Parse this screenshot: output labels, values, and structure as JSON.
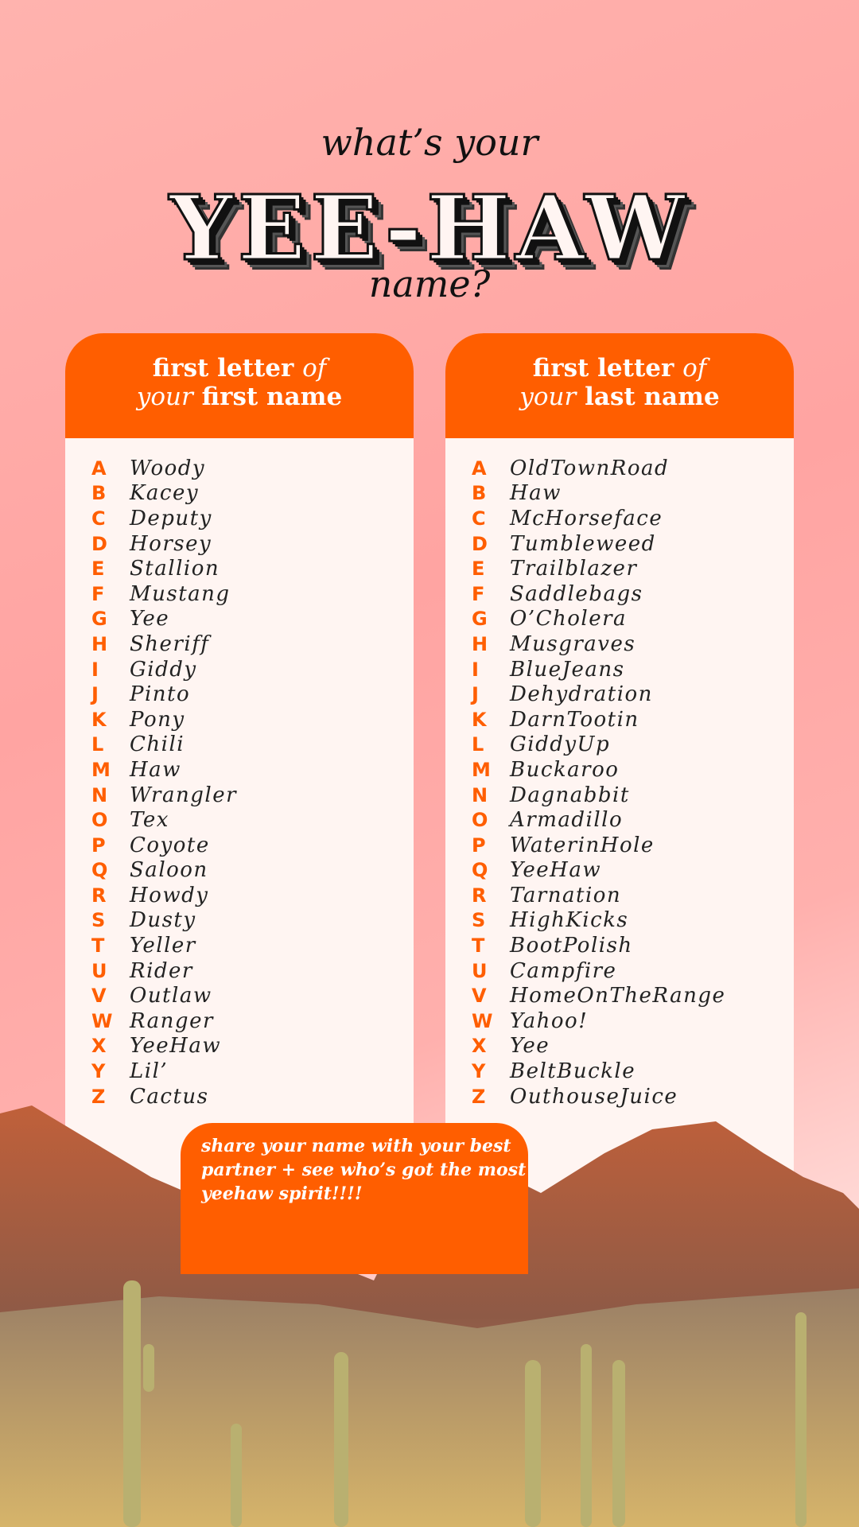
{
  "header": {
    "line1": "what’s your",
    "title": "YEE-HAW",
    "line3": "name?"
  },
  "cards": [
    {
      "head": {
        "a": "first letter",
        "b": "of",
        "c": "your",
        "d": "first name"
      },
      "rows": [
        [
          "A",
          "Woody"
        ],
        [
          "B",
          "Kacey"
        ],
        [
          "C",
          "Deputy"
        ],
        [
          "D",
          "Horsey"
        ],
        [
          "E",
          "Stallion"
        ],
        [
          "F",
          "Mustang"
        ],
        [
          "G",
          "Yee"
        ],
        [
          "H",
          "Sheriff"
        ],
        [
          "I",
          "Giddy"
        ],
        [
          "J",
          "Pinto"
        ],
        [
          "K",
          "Pony"
        ],
        [
          "L",
          "Chili"
        ],
        [
          "M",
          "Haw"
        ],
        [
          "N",
          "Wrangler"
        ],
        [
          "O",
          "Tex"
        ],
        [
          "P",
          "Coyote"
        ],
        [
          "Q",
          "Saloon"
        ],
        [
          "R",
          "Howdy"
        ],
        [
          "S",
          "Dusty"
        ],
        [
          "T",
          "Yeller"
        ],
        [
          "U",
          "Rider"
        ],
        [
          "V",
          "Outlaw"
        ],
        [
          "W",
          "Ranger"
        ],
        [
          "X",
          "YeeHaw"
        ],
        [
          "Y",
          "Lil’"
        ],
        [
          "Z",
          "Cactus"
        ]
      ]
    },
    {
      "head": {
        "a": "first letter",
        "b": "of",
        "c": "your",
        "d": "last name"
      },
      "rows": [
        [
          "A",
          "OldTownRoad"
        ],
        [
          "B",
          "Haw"
        ],
        [
          "C",
          "McHorseface"
        ],
        [
          "D",
          "Tumbleweed"
        ],
        [
          "E",
          "Trailblazer"
        ],
        [
          "F",
          "Saddlebags"
        ],
        [
          "G",
          "O’Cholera"
        ],
        [
          "H",
          "Musgraves"
        ],
        [
          "I",
          "BlueJeans"
        ],
        [
          "J",
          "Dehydration"
        ],
        [
          "K",
          "DarnTootin"
        ],
        [
          "L",
          "GiddyUp"
        ],
        [
          "M",
          "Buckaroo"
        ],
        [
          "N",
          "Dagnabbit"
        ],
        [
          "O",
          "Armadillo"
        ],
        [
          "P",
          "WaterinHole"
        ],
        [
          "Q",
          "YeeHaw"
        ],
        [
          "R",
          "Tarnation"
        ],
        [
          "S",
          "HighKicks"
        ],
        [
          "T",
          "BootPolish"
        ],
        [
          "U",
          "Campfire"
        ],
        [
          "V",
          "HomeOnTheRange"
        ],
        [
          "W",
          "Yahoo!"
        ],
        [
          "X",
          "Yee"
        ],
        [
          "Y",
          "BeltBuckle"
        ],
        [
          "Z",
          "OuthouseJuice"
        ]
      ]
    }
  ],
  "bubble": {
    "text": "share your name with your best partner + see who’s got the most yeehaw spirit!!!!"
  },
  "colors": {
    "accent": "#ff5e00",
    "card": "#fff5f2",
    "background": "#ffa4a2"
  }
}
